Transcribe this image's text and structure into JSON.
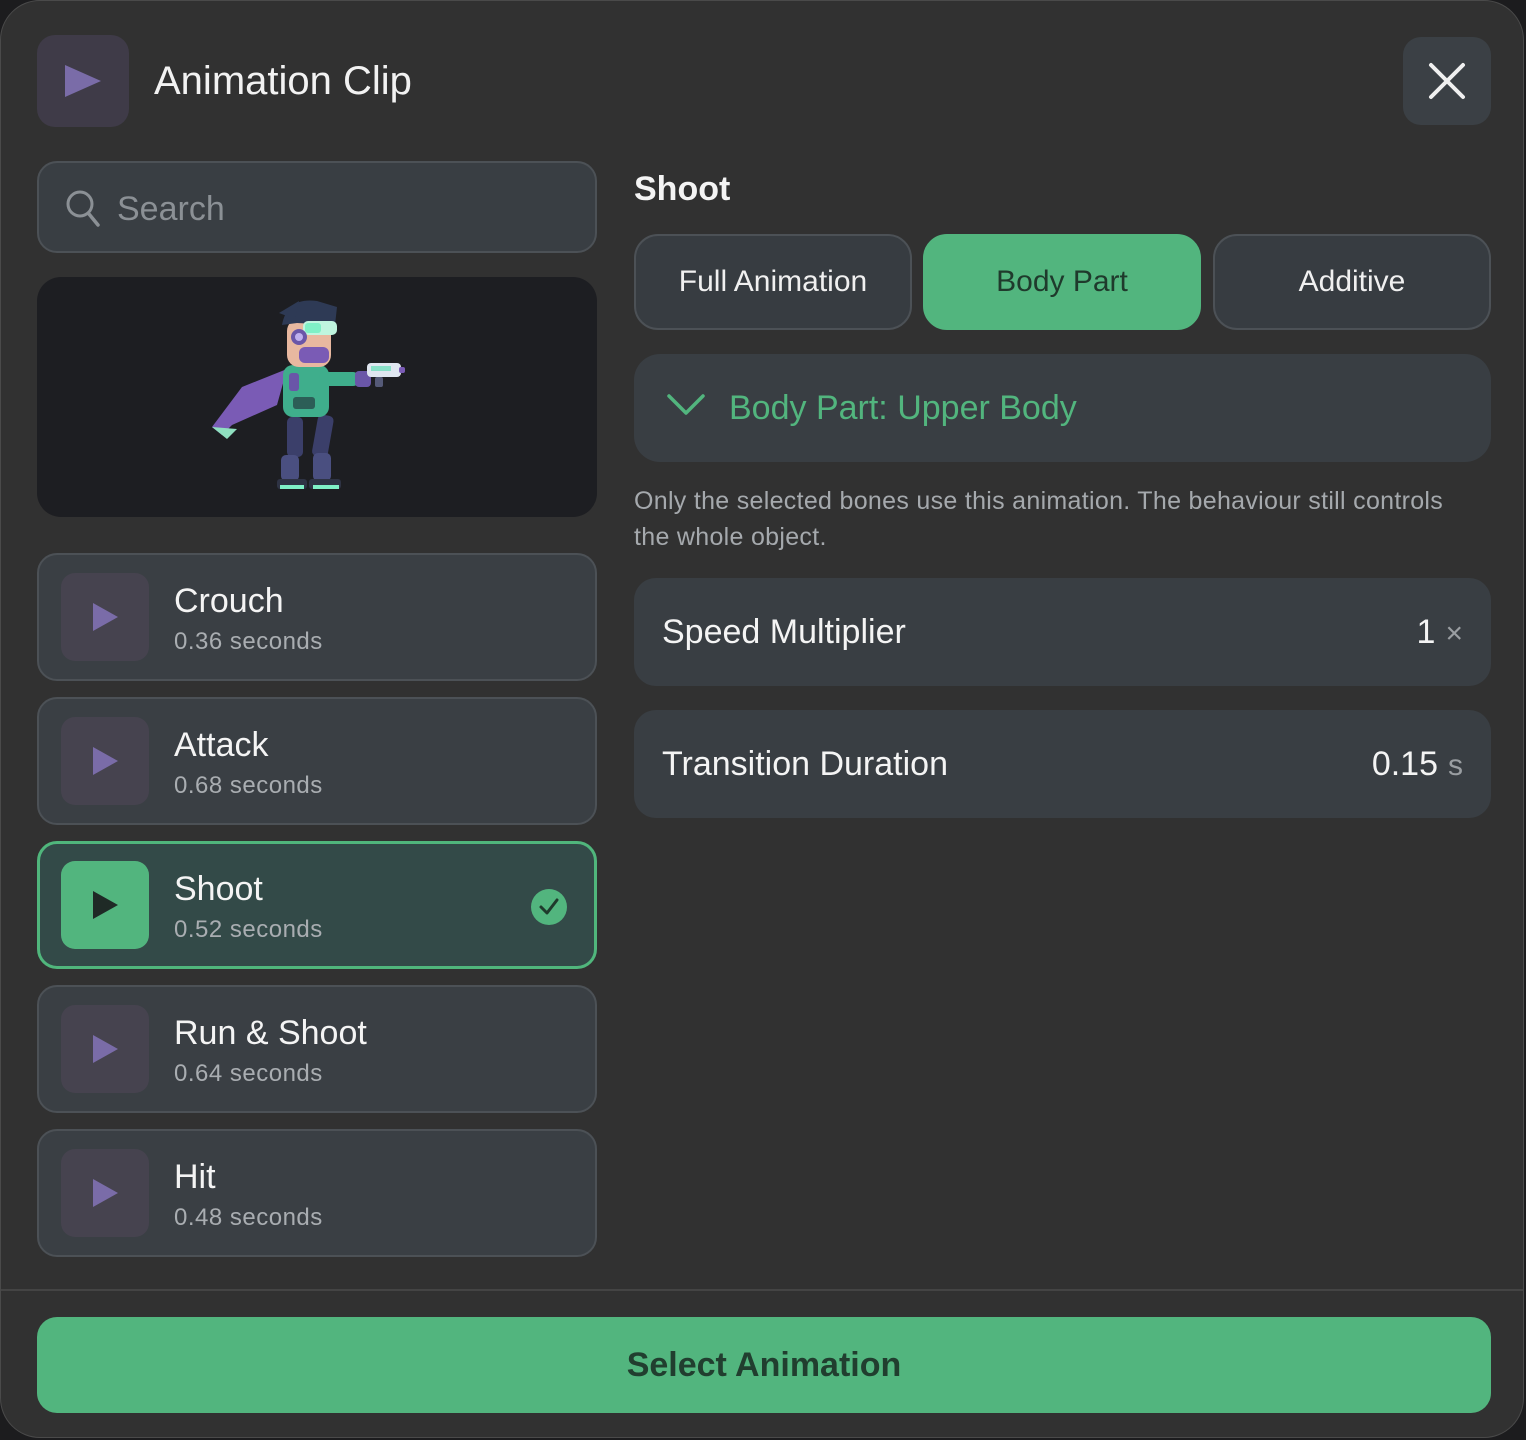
{
  "header": {
    "title": "Animation Clip",
    "header_icon": "play-icon",
    "close_icon": "close-icon"
  },
  "search": {
    "placeholder": "Search",
    "value": ""
  },
  "clips": [
    {
      "name": "Crouch",
      "duration": "0.36 seconds",
      "selected": false
    },
    {
      "name": "Attack",
      "duration": "0.68 seconds",
      "selected": false
    },
    {
      "name": "Shoot",
      "duration": "0.52 seconds",
      "selected": true
    },
    {
      "name": "Run & Shoot",
      "duration": "0.64 seconds",
      "selected": false
    },
    {
      "name": "Hit",
      "duration": "0.48 seconds",
      "selected": false
    }
  ],
  "detail": {
    "title": "Shoot",
    "modes": [
      "Full Animation",
      "Body Part",
      "Additive"
    ],
    "active_mode": "Body Part",
    "body_part_label": "Body Part: Upper Body",
    "description": "Only the selected bones use this animation. The behaviour still controls the whole object.",
    "speed": {
      "label": "Speed Multiplier",
      "value": "1",
      "unit": "×"
    },
    "transition": {
      "label": "Transition Duration",
      "value": "0.15",
      "unit": "s"
    }
  },
  "footer": {
    "primary_label": "Select Animation"
  },
  "colors": {
    "accent": "#52b57e",
    "purple": "#7a6ca8",
    "panel": "#313131",
    "field": "#393e43"
  }
}
